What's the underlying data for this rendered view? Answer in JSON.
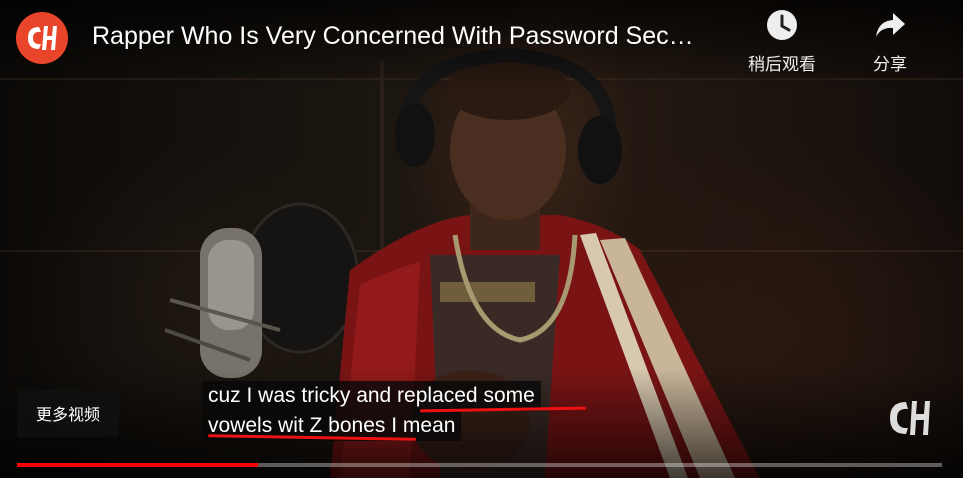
{
  "video": {
    "title": "Rapper Who Is Very Concerned With Password Sec…",
    "channel_logo_text": "CH"
  },
  "actions": {
    "watch_later": "稍后观看",
    "share": "分享"
  },
  "more_videos_label": "更多视频",
  "captions": {
    "line1": "cuz I was tricky and replaced some",
    "line2": "vowels wit Z bones I mean"
  },
  "watermark_text": "CH",
  "progress": {
    "played_fraction": 0.26
  },
  "colors": {
    "brand": "#e8452a",
    "progress": "#ff0000",
    "annotation_underline": "#e11111"
  },
  "icons": {
    "watch_later": "clock-icon",
    "share": "share-arrow-icon"
  }
}
